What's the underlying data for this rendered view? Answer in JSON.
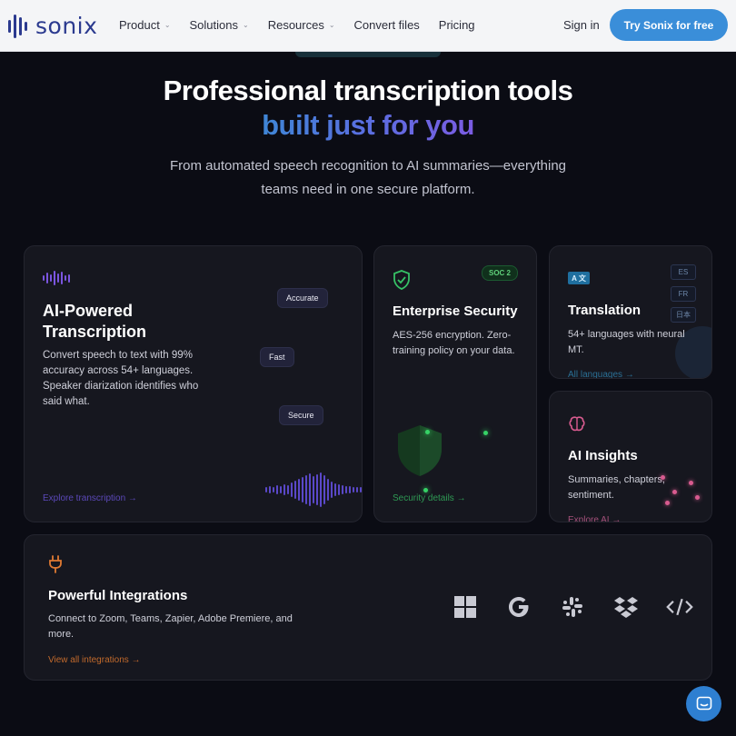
{
  "nav": {
    "logo_text": "sonix",
    "links": [
      {
        "label": "Product",
        "has_caret": true
      },
      {
        "label": "Solutions",
        "has_caret": true
      },
      {
        "label": "Resources",
        "has_caret": true
      },
      {
        "label": "Convert files",
        "has_caret": false
      },
      {
        "label": "Pricing",
        "has_caret": false
      }
    ],
    "caret_glyph": "⌄",
    "signin_label": "Sign in",
    "cta_label": "Try Sonix for free"
  },
  "hero": {
    "title": "Professional transcription tools",
    "subtitle": "built just for you",
    "description": "From automated speech recognition to AI summaries—everything teams need in one secure platform."
  },
  "cards": {
    "ai": {
      "title": "AI-Powered Transcription",
      "description": "Convert speech to text with 99% accuracy across 54+ languages. Speaker diarization identifies who said what.",
      "chips": [
        "Accurate",
        "Fast",
        "Secure"
      ],
      "link": "Explore transcription →",
      "icon": "waveform-icon"
    },
    "security": {
      "badge": "SOC 2",
      "title": "Enterprise Security",
      "description": "AES-256 encryption. Zero-training policy on your data.",
      "link": "Security details →",
      "icon": "shield-check-icon"
    },
    "translation": {
      "title": "Translation",
      "description": "54+ languages with neural MT.",
      "languages": [
        "ES",
        "FR",
        "日本"
      ],
      "link": "All languages →",
      "icon": "translate-icon"
    },
    "insights": {
      "title": "AI Insights",
      "description": "Summaries, chapters, sentiment.",
      "link": "Explore AI →",
      "icon": "brain-icon"
    },
    "integrations": {
      "title": "Powerful Integrations",
      "description": "Connect to Zoom, Teams, Zapier, Adobe Premiere, and more.",
      "link": "View all integrations →",
      "icon": "plug-icon",
      "logos": [
        "windows-icon",
        "google-icon",
        "slack-icon",
        "dropbox-icon",
        "code-icon"
      ]
    }
  },
  "colors": {
    "accent_blue": "#3a8ed9",
    "purple": "#7b55e0",
    "green": "#36d366",
    "pink": "#d85b8f",
    "orange": "#c26a2c",
    "background": "#0b0c14"
  },
  "chat": {
    "icon": "chat-icon"
  }
}
